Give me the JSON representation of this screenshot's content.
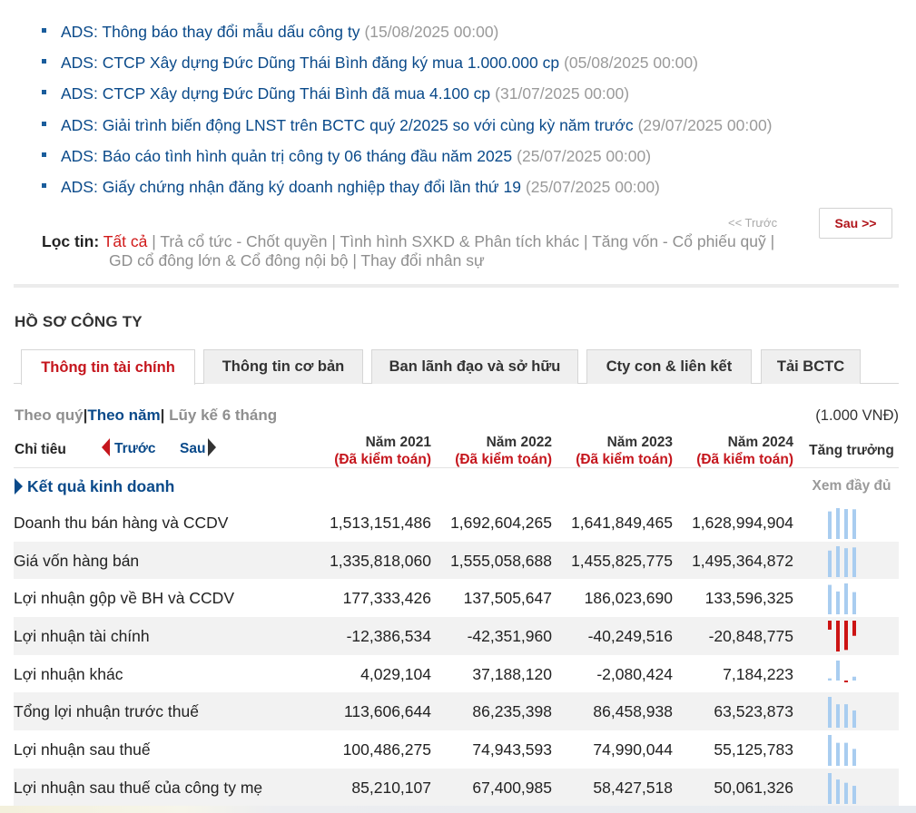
{
  "news": [
    {
      "title": "ADS: Thông báo thay đổi mẫu dấu công ty",
      "date": "(15/08/2025 00:00)"
    },
    {
      "title": "ADS: CTCP Xây dựng Đức Dũng Thái Bình đăng ký mua 1.000.000 cp",
      "date": "(05/08/2025 00:00)"
    },
    {
      "title": "ADS: CTCP Xây dựng Đức Dũng Thái Bình đã mua 4.100 cp",
      "date": "(31/07/2025 00:00)"
    },
    {
      "title": "ADS: Giải trình biến động LNST trên BCTC quý 2/2025 so với cùng kỳ năm trước",
      "date": "(29/07/2025 00:00)"
    },
    {
      "title": "ADS: Báo cáo tình hình quản trị công ty 06 tháng đầu năm 2025",
      "date": "(25/07/2025 00:00)"
    },
    {
      "title": "ADS: Giấy chứng nhận đăng ký doanh nghiệp thay đổi lần thứ 19",
      "date": "(25/07/2025 00:00)"
    }
  ],
  "pager": {
    "prev": "<< Trước",
    "next": "Sau >>"
  },
  "filter": {
    "label": "Lọc tin",
    "colon": ":",
    "active": "Tất cả",
    "options": [
      "Trả cổ tức - Chốt quyền",
      "Tình hình SXKD & Phân tích khác",
      "Tăng vốn - Cổ phiếu quỹ",
      "GD cổ đông lớn & Cổ đông nội bộ",
      "Thay đổi nhân sự"
    ],
    "separator": "|"
  },
  "section_title": "HỒ SƠ CÔNG TY",
  "tabs": [
    "Thông tin tài chính",
    "Thông tin cơ bản",
    "Ban lãnh đạo và sở hữu",
    "Cty con & liên kết",
    "Tải BCTC"
  ],
  "period": {
    "quarter": "Theo quý",
    "year": "Theo năm",
    "ytd": "Lũy kế 6 tháng",
    "sep": "|"
  },
  "unit": "(1.000 VNĐ)",
  "table_header": {
    "indicator": "Chỉ tiêu",
    "prev": "Trước",
    "next": "Sau",
    "columns": [
      {
        "year": "Năm 2021",
        "audit": "(Đã kiểm toán)"
      },
      {
        "year": "Năm 2022",
        "audit": "(Đã kiểm toán)"
      },
      {
        "year": "Năm 2023",
        "audit": "(Đã kiểm toán)"
      },
      {
        "year": "Năm 2024",
        "audit": "(Đã kiểm toán)"
      }
    ],
    "growth": "Tăng trưởng"
  },
  "group": {
    "label": "Kết quả kinh doanh",
    "view_full": "Xem đầy đủ"
  },
  "colors": {
    "positive_bar": "#a9cdf0",
    "negative_bar": "#cc1414",
    "link": "#0a4a8a",
    "accent_red": "#c5161d"
  },
  "rows": [
    {
      "label": "Doanh thu bán hàng và CCDV",
      "values": [
        "1,513,151,486",
        "1,692,604,265",
        "1,641,849,465",
        "1,628,994,904"
      ],
      "series": [
        1513151486,
        1692604265,
        1641849465,
        1628994904
      ]
    },
    {
      "label": "Giá vốn hàng bán",
      "values": [
        "1,335,818,060",
        "1,555,058,688",
        "1,455,825,775",
        "1,495,364,872"
      ],
      "series": [
        1335818060,
        1555058688,
        1455825775,
        1495364872
      ]
    },
    {
      "label": "Lợi nhuận gộp về BH và CCDV",
      "values": [
        "177,333,426",
        "137,505,647",
        "186,023,690",
        "133,596,325"
      ],
      "series": [
        177333426,
        137505647,
        186023690,
        133596325
      ]
    },
    {
      "label": "Lợi nhuận tài chính",
      "values": [
        "-12,386,534",
        "-42,351,960",
        "-40,249,516",
        "-20,848,775"
      ],
      "series": [
        -12386534,
        -42351960,
        -40249516,
        -20848775
      ]
    },
    {
      "label": "Lợi nhuận khác",
      "values": [
        "4,029,104",
        "37,188,120",
        "-2,080,424",
        "7,184,223"
      ],
      "series": [
        4029104,
        37188120,
        -2080424,
        7184223
      ]
    },
    {
      "label": "Tổng lợi nhuận trước thuế",
      "values": [
        "113,606,644",
        "86,235,398",
        "86,458,938",
        "63,523,873"
      ],
      "series": [
        113606644,
        86235398,
        86458938,
        63523873
      ]
    },
    {
      "label": "Lợi nhuận sau thuế",
      "values": [
        "100,486,275",
        "74,943,593",
        "74,990,044",
        "55,125,783"
      ],
      "series": [
        100486275,
        74943593,
        74990044,
        55125783
      ]
    },
    {
      "label": "Lợi nhuận sau thuế của công ty mẹ",
      "values": [
        "85,210,107",
        "67,400,985",
        "58,427,518",
        "50,061,326"
      ],
      "series": [
        85210107,
        67400985,
        58427518,
        50061326
      ]
    }
  ]
}
